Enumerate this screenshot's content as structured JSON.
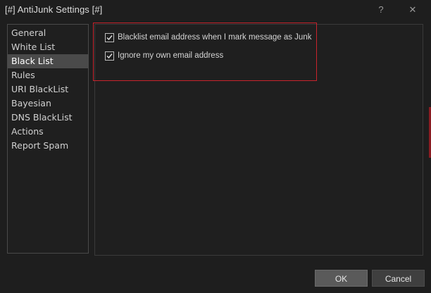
{
  "window": {
    "title": "[#] AntiJunk Settings [#]",
    "help_label": "?",
    "close_label": "✕"
  },
  "sidebar": {
    "items": [
      {
        "label": "General"
      },
      {
        "label": "White List"
      },
      {
        "label": "Black List",
        "selected": true
      },
      {
        "label": "Rules"
      },
      {
        "label": "URI BlackList"
      },
      {
        "label": "Bayesian"
      },
      {
        "label": "DNS BlackList"
      },
      {
        "label": "Actions"
      },
      {
        "label": "Report Spam"
      }
    ]
  },
  "options": [
    {
      "label": "Blacklist email address when I mark message as Junk",
      "checked": true
    },
    {
      "label": "Ignore my own email address",
      "checked": true
    }
  ],
  "buttons": {
    "ok_label": "OK",
    "cancel_label": "Cancel"
  },
  "colors": {
    "background": "#1e1e1e",
    "selected_item": "#4a4a4a",
    "highlight_border": "#c8232c"
  },
  "icons": {
    "help": "help-icon",
    "close": "close-icon",
    "check": "checkmark-icon"
  }
}
